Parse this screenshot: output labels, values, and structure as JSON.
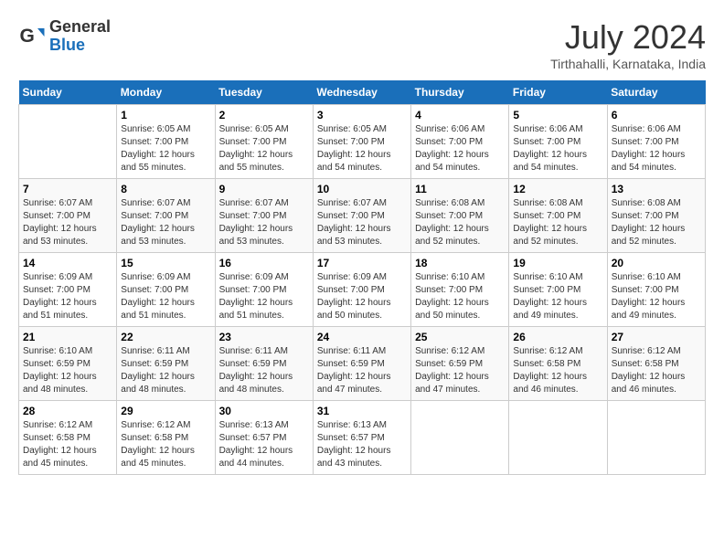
{
  "header": {
    "logo_line1": "General",
    "logo_line2": "Blue",
    "month_year": "July 2024",
    "location": "Tirthahalli, Karnataka, India"
  },
  "days_of_week": [
    "Sunday",
    "Monday",
    "Tuesday",
    "Wednesday",
    "Thursday",
    "Friday",
    "Saturday"
  ],
  "weeks": [
    [
      {
        "day": "",
        "info": ""
      },
      {
        "day": "1",
        "info": "Sunrise: 6:05 AM\nSunset: 7:00 PM\nDaylight: 12 hours\nand 55 minutes."
      },
      {
        "day": "2",
        "info": "Sunrise: 6:05 AM\nSunset: 7:00 PM\nDaylight: 12 hours\nand 55 minutes."
      },
      {
        "day": "3",
        "info": "Sunrise: 6:05 AM\nSunset: 7:00 PM\nDaylight: 12 hours\nand 54 minutes."
      },
      {
        "day": "4",
        "info": "Sunrise: 6:06 AM\nSunset: 7:00 PM\nDaylight: 12 hours\nand 54 minutes."
      },
      {
        "day": "5",
        "info": "Sunrise: 6:06 AM\nSunset: 7:00 PM\nDaylight: 12 hours\nand 54 minutes."
      },
      {
        "day": "6",
        "info": "Sunrise: 6:06 AM\nSunset: 7:00 PM\nDaylight: 12 hours\nand 54 minutes."
      }
    ],
    [
      {
        "day": "7",
        "info": "Sunrise: 6:07 AM\nSunset: 7:00 PM\nDaylight: 12 hours\nand 53 minutes."
      },
      {
        "day": "8",
        "info": "Sunrise: 6:07 AM\nSunset: 7:00 PM\nDaylight: 12 hours\nand 53 minutes."
      },
      {
        "day": "9",
        "info": "Sunrise: 6:07 AM\nSunset: 7:00 PM\nDaylight: 12 hours\nand 53 minutes."
      },
      {
        "day": "10",
        "info": "Sunrise: 6:07 AM\nSunset: 7:00 PM\nDaylight: 12 hours\nand 53 minutes."
      },
      {
        "day": "11",
        "info": "Sunrise: 6:08 AM\nSunset: 7:00 PM\nDaylight: 12 hours\nand 52 minutes."
      },
      {
        "day": "12",
        "info": "Sunrise: 6:08 AM\nSunset: 7:00 PM\nDaylight: 12 hours\nand 52 minutes."
      },
      {
        "day": "13",
        "info": "Sunrise: 6:08 AM\nSunset: 7:00 PM\nDaylight: 12 hours\nand 52 minutes."
      }
    ],
    [
      {
        "day": "14",
        "info": "Sunrise: 6:09 AM\nSunset: 7:00 PM\nDaylight: 12 hours\nand 51 minutes."
      },
      {
        "day": "15",
        "info": "Sunrise: 6:09 AM\nSunset: 7:00 PM\nDaylight: 12 hours\nand 51 minutes."
      },
      {
        "day": "16",
        "info": "Sunrise: 6:09 AM\nSunset: 7:00 PM\nDaylight: 12 hours\nand 51 minutes."
      },
      {
        "day": "17",
        "info": "Sunrise: 6:09 AM\nSunset: 7:00 PM\nDaylight: 12 hours\nand 50 minutes."
      },
      {
        "day": "18",
        "info": "Sunrise: 6:10 AM\nSunset: 7:00 PM\nDaylight: 12 hours\nand 50 minutes."
      },
      {
        "day": "19",
        "info": "Sunrise: 6:10 AM\nSunset: 7:00 PM\nDaylight: 12 hours\nand 49 minutes."
      },
      {
        "day": "20",
        "info": "Sunrise: 6:10 AM\nSunset: 7:00 PM\nDaylight: 12 hours\nand 49 minutes."
      }
    ],
    [
      {
        "day": "21",
        "info": "Sunrise: 6:10 AM\nSunset: 6:59 PM\nDaylight: 12 hours\nand 48 minutes."
      },
      {
        "day": "22",
        "info": "Sunrise: 6:11 AM\nSunset: 6:59 PM\nDaylight: 12 hours\nand 48 minutes."
      },
      {
        "day": "23",
        "info": "Sunrise: 6:11 AM\nSunset: 6:59 PM\nDaylight: 12 hours\nand 48 minutes."
      },
      {
        "day": "24",
        "info": "Sunrise: 6:11 AM\nSunset: 6:59 PM\nDaylight: 12 hours\nand 47 minutes."
      },
      {
        "day": "25",
        "info": "Sunrise: 6:12 AM\nSunset: 6:59 PM\nDaylight: 12 hours\nand 47 minutes."
      },
      {
        "day": "26",
        "info": "Sunrise: 6:12 AM\nSunset: 6:58 PM\nDaylight: 12 hours\nand 46 minutes."
      },
      {
        "day": "27",
        "info": "Sunrise: 6:12 AM\nSunset: 6:58 PM\nDaylight: 12 hours\nand 46 minutes."
      }
    ],
    [
      {
        "day": "28",
        "info": "Sunrise: 6:12 AM\nSunset: 6:58 PM\nDaylight: 12 hours\nand 45 minutes."
      },
      {
        "day": "29",
        "info": "Sunrise: 6:12 AM\nSunset: 6:58 PM\nDaylight: 12 hours\nand 45 minutes."
      },
      {
        "day": "30",
        "info": "Sunrise: 6:13 AM\nSunset: 6:57 PM\nDaylight: 12 hours\nand 44 minutes."
      },
      {
        "day": "31",
        "info": "Sunrise: 6:13 AM\nSunset: 6:57 PM\nDaylight: 12 hours\nand 43 minutes."
      },
      {
        "day": "",
        "info": ""
      },
      {
        "day": "",
        "info": ""
      },
      {
        "day": "",
        "info": ""
      }
    ]
  ]
}
